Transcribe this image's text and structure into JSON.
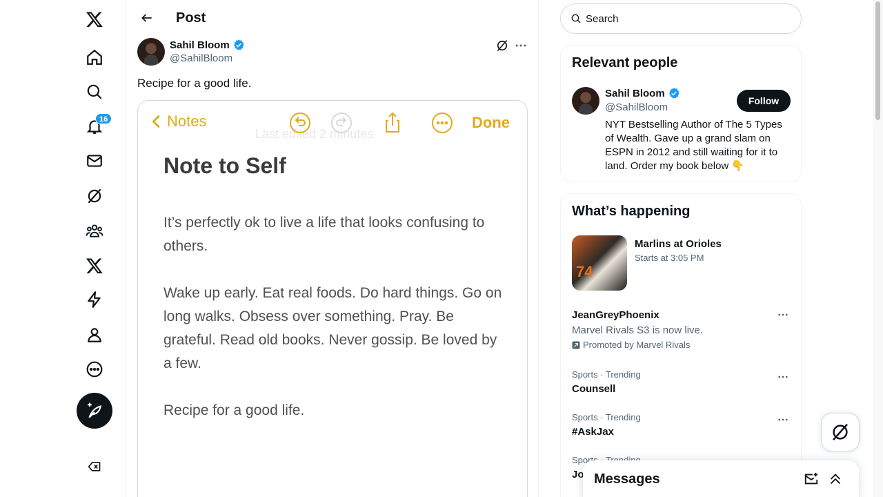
{
  "nav": {
    "notifications_badge": "16",
    "items": [
      "x-logo",
      "home",
      "explore",
      "notifications",
      "messages",
      "grok",
      "communities",
      "premium",
      "verified-orgs",
      "profile",
      "more"
    ]
  },
  "header": {
    "title": "Post"
  },
  "post": {
    "author_name": "Sahil Bloom",
    "author_handle": "@SahilBloom",
    "text": "Recipe for a good life."
  },
  "note_image": {
    "back_label": "Notes",
    "done_label": "Done",
    "ghost_text": "Last edited 2 minutes",
    "title": "Note to Self",
    "para1": "It’s perfectly ok to live a life that looks confusing to others.",
    "para2": "Wake up early. Eat real foods. Do hard things. Go on long walks. Obsess over something. Pray. Be grateful. Read old books. Never gossip. Be loved by a few.",
    "para3": "Recipe for a good life."
  },
  "search": {
    "placeholder": "Search"
  },
  "relevant_people": {
    "title": "Relevant people",
    "name": "Sahil Bloom",
    "handle": "@SahilBloom",
    "follow_label": "Follow",
    "bio": "NYT Bestselling Author of The 5 Types of Wealth. Gave up a grand slam on ESPN in 2012 and still waiting for it to land. Order my book below 👇"
  },
  "happening": {
    "title": "What’s happening",
    "event_title": "Marlins at Orioles",
    "event_time": "Starts at 3:05 PM",
    "promo_account": "JeanGreyPhoenix",
    "promo_text": "Marvel Rivals S3 is now live.",
    "promo_by": "Promoted by Marvel Rivals",
    "trends": [
      {
        "meta": "Sports · Trending",
        "name": "Counsell"
      },
      {
        "meta": "Sports · Trending",
        "name": "#AskJax"
      },
      {
        "meta": "Sports · Trending",
        "name": "Jo"
      }
    ]
  },
  "messages": {
    "title": "Messages"
  },
  "colors": {
    "accent": "#1d9bf0",
    "notes_yellow": "#e2aa1a",
    "text": "#0f1419",
    "muted": "#536471"
  }
}
